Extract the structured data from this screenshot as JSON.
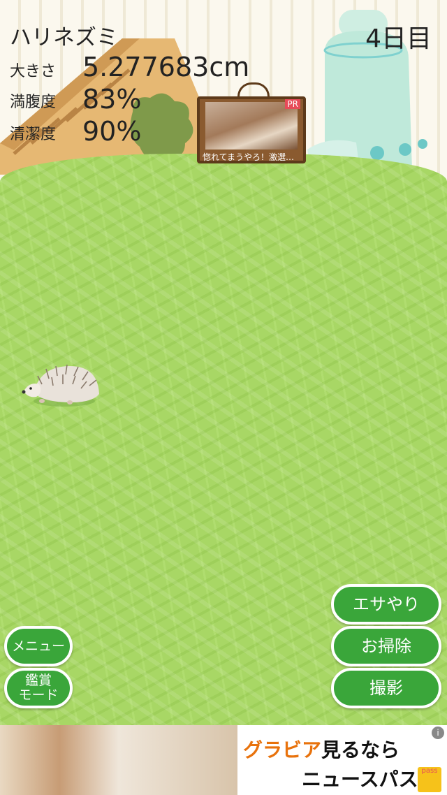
{
  "pet": {
    "name": "ハリネズミ",
    "day": "4日目"
  },
  "stats": [
    {
      "label": "大きさ",
      "value": "5.277683cm"
    },
    {
      "label": "満腹度",
      "value": "83%"
    },
    {
      "label": "清潔度",
      "value": "90%"
    }
  ],
  "sign_ad": {
    "badge": "PR",
    "text": "惚れてまうやろ！激選…"
  },
  "buttons": {
    "feed": "エサやり",
    "clean": "お掃除",
    "photo": "撮影",
    "menu": "メニュー",
    "view_mode_1": "鑑賞",
    "view_mode_2": "モード"
  },
  "banner_ad": {
    "line1_highlight": "グラビア",
    "line1_rest": "見るなら",
    "line2": "ニュースパス",
    "logo": "pass",
    "info": "i"
  },
  "colors": {
    "button_green": "#3aa63a",
    "hay_green": "#a8d765",
    "banner_highlight": "#e8720c"
  }
}
